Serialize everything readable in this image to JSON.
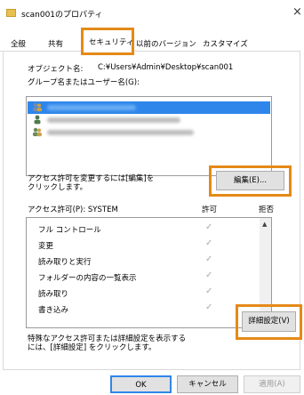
{
  "window": {
    "title": "scan001のプロパティ",
    "close_glyph": "×"
  },
  "tabs": [
    {
      "label": "全般"
    },
    {
      "label": "共有"
    },
    {
      "label": "セキュリティ"
    },
    {
      "label": "以前のバージョン"
    },
    {
      "label": "カスタマイズ"
    }
  ],
  "object": {
    "label": "オブジェクト名:",
    "path": "C:¥Users¥Admin¥Desktop¥scan001"
  },
  "group_label": "グループ名またはユーザー名(G):",
  "users": {
    "selected_index": 0,
    "icons": [
      "users-icon",
      "user-icon",
      "users-icon"
    ]
  },
  "edit": {
    "hint": "アクセス許可を変更するには[編集]を\nクリックします。",
    "button": "編集(E)..."
  },
  "permissions": {
    "header_label": "アクセス許可(P): SYSTEM",
    "col_allow": "許可",
    "col_deny": "拒否",
    "rows": [
      {
        "name": "フル コントロール",
        "allow": "✓"
      },
      {
        "name": "変更",
        "allow": "✓"
      },
      {
        "name": "読み取りと実行",
        "allow": "✓"
      },
      {
        "name": "フォルダーの内容の一覧表示",
        "allow": "✓"
      },
      {
        "name": "読み取り",
        "allow": "✓"
      },
      {
        "name": "書き込み",
        "allow": "✓"
      }
    ]
  },
  "advanced": {
    "hint": "特殊なアクセス許可または詳細設定を表示する\nには、[詳細設定] をクリックします。",
    "button": "詳細設定(V)"
  },
  "footer": {
    "ok": "OK",
    "cancel": "キャンセル",
    "apply": "適用(A)"
  },
  "colors": {
    "highlight_frame": "#e58a17",
    "selection": "#2f86ea"
  }
}
